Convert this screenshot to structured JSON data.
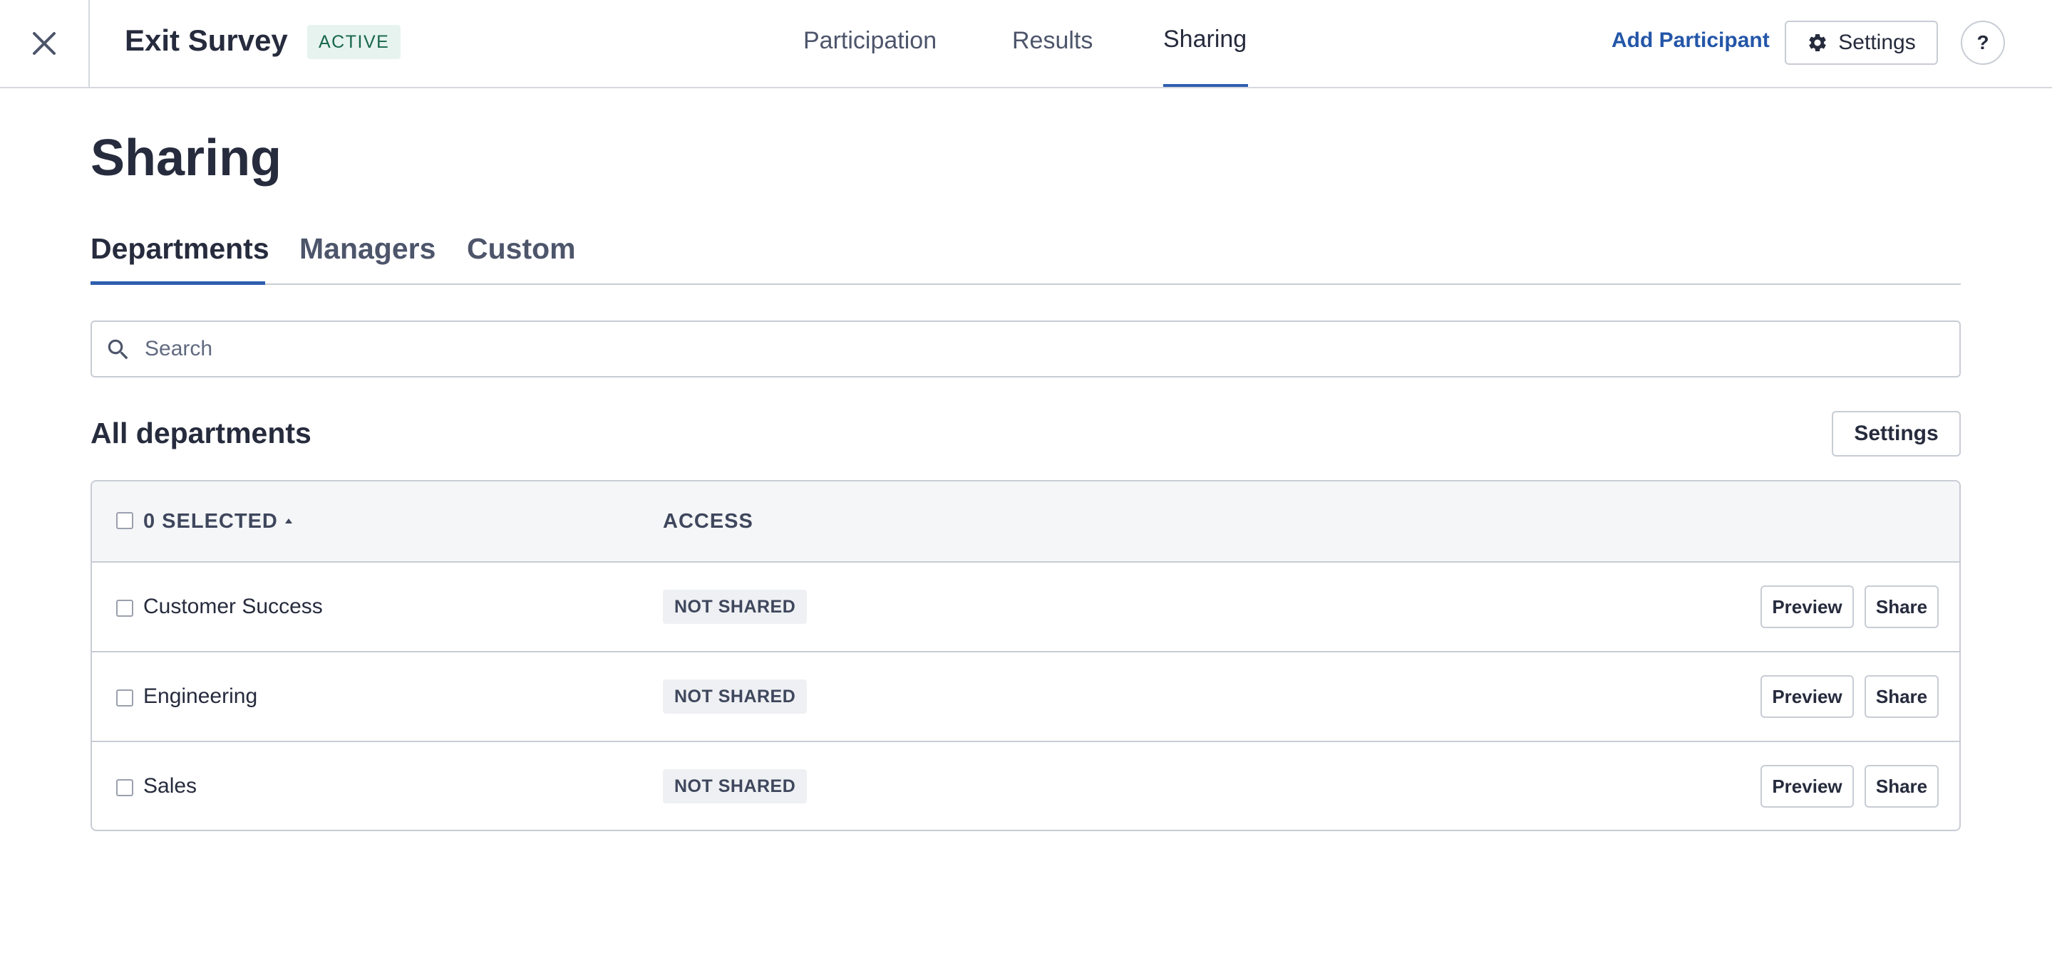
{
  "header": {
    "title": "Exit Survey",
    "status": "ACTIVE",
    "tabs": [
      {
        "label": "Participation"
      },
      {
        "label": "Results"
      },
      {
        "label": "Sharing"
      }
    ],
    "add_participant_label": "Add Participant",
    "settings_label": "Settings",
    "help_label": "?"
  },
  "page": {
    "title": "Sharing",
    "subtabs": [
      {
        "label": "Departments"
      },
      {
        "label": "Managers"
      },
      {
        "label": "Custom"
      }
    ],
    "search": {
      "placeholder": "Search",
      "value": ""
    },
    "section_title": "All departments",
    "section_settings_label": "Settings"
  },
  "table": {
    "columns": {
      "selected": "0 SELECTED",
      "access": "ACCESS"
    },
    "rows": [
      {
        "name": "Customer Success",
        "access": "NOT SHARED",
        "preview_label": "Preview",
        "share_label": "Share"
      },
      {
        "name": "Engineering",
        "access": "NOT SHARED",
        "preview_label": "Preview",
        "share_label": "Share"
      },
      {
        "name": "Sales",
        "access": "NOT SHARED",
        "preview_label": "Preview",
        "share_label": "Share"
      }
    ]
  },
  "icons": {
    "close": "close-icon",
    "gear": "gear-icon",
    "search": "search-icon",
    "sort": "sort-ascending-icon"
  },
  "colors": {
    "accent": "#2e5fb0",
    "link": "#2456a8",
    "status_bg": "#e6f3ee",
    "status_text": "#17664b",
    "text": "#262b3d"
  }
}
